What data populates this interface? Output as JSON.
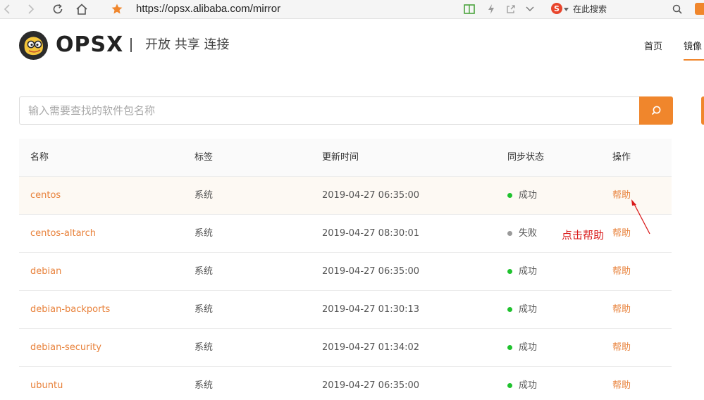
{
  "browser": {
    "url": "https://opsx.alibaba.com/mirror",
    "search_engine_label": "在此搜索"
  },
  "header": {
    "brand": "OPSX",
    "slogan": "开放 共享 连接",
    "nav": [
      {
        "label": "首页"
      },
      {
        "label": "镜像"
      }
    ]
  },
  "search": {
    "placeholder": "输入需要查找的软件包名称",
    "value": ""
  },
  "table": {
    "headers": {
      "name": "名称",
      "tag": "标签",
      "updated": "更新时间",
      "status": "同步状态",
      "action": "操作"
    },
    "rows": [
      {
        "name": "centos",
        "tag": "系统",
        "updated": "2019-04-27 06:35:00",
        "status": "成功",
        "status_color": "#1fc22e",
        "action": "帮助"
      },
      {
        "name": "centos-altarch",
        "tag": "系统",
        "updated": "2019-04-27 08:30:01",
        "status": "失败",
        "status_color": "#9a9a9a",
        "action": "帮助"
      },
      {
        "name": "debian",
        "tag": "系统",
        "updated": "2019-04-27 06:35:00",
        "status": "成功",
        "status_color": "#1fc22e",
        "action": "帮助"
      },
      {
        "name": "debian-backports",
        "tag": "系统",
        "updated": "2019-04-27 01:30:13",
        "status": "成功",
        "status_color": "#1fc22e",
        "action": "帮助"
      },
      {
        "name": "debian-security",
        "tag": "系统",
        "updated": "2019-04-27 01:34:02",
        "status": "成功",
        "status_color": "#1fc22e",
        "action": "帮助"
      },
      {
        "name": "ubuntu",
        "tag": "系统",
        "updated": "2019-04-27 06:35:00",
        "status": "成功",
        "status_color": "#1fc22e",
        "action": "帮助"
      }
    ]
  },
  "annotation": {
    "text": "点击帮助",
    "color": "#d91a1a"
  },
  "colors": {
    "accent": "#f0862c",
    "link": "#e8813a"
  }
}
